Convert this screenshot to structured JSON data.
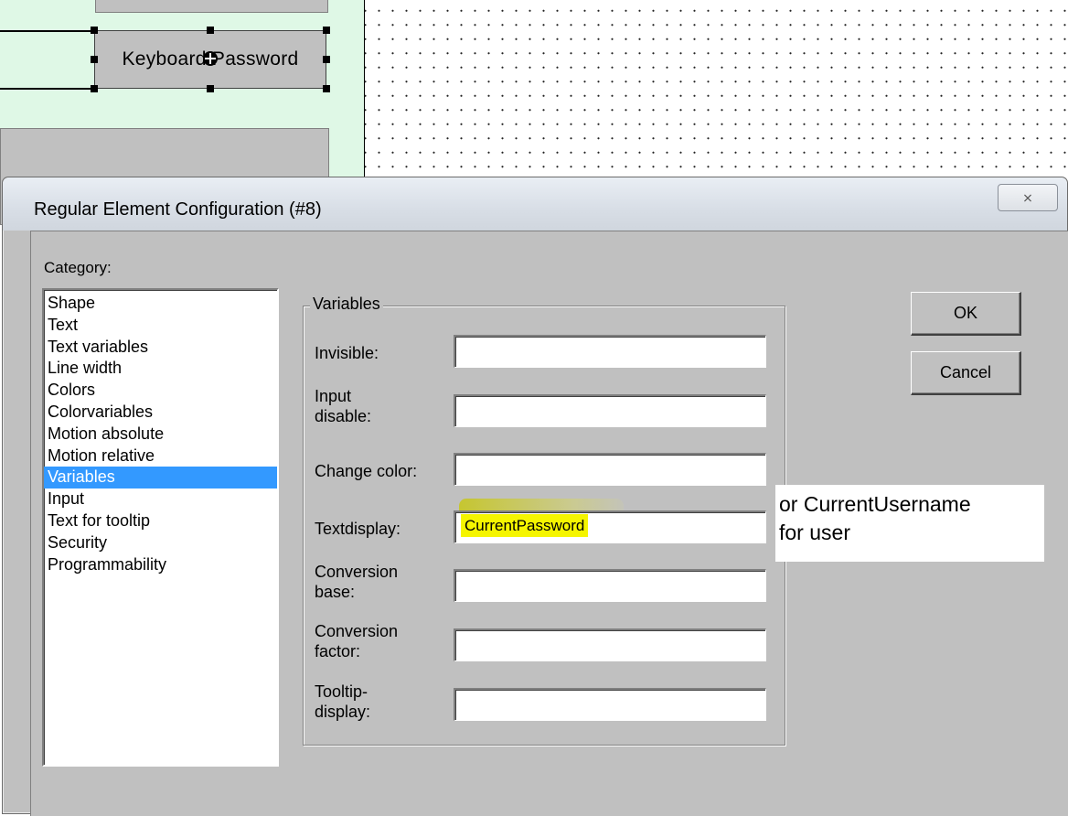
{
  "editor": {
    "selected_element_text": "Keyboard Password"
  },
  "dialog": {
    "title": "Regular Element Configuration (#8)",
    "close_label": "⨯",
    "category_label": "Category:",
    "categories": [
      {
        "label": "Shape"
      },
      {
        "label": "Text"
      },
      {
        "label": "Text variables"
      },
      {
        "label": "Line width"
      },
      {
        "label": "Colors"
      },
      {
        "label": "Colorvariables"
      },
      {
        "label": "Motion absolute"
      },
      {
        "label": "Motion relative"
      },
      {
        "label": "Variables",
        "selected": true
      },
      {
        "label": "Input"
      },
      {
        "label": "Text for tooltip"
      },
      {
        "label": "Security"
      },
      {
        "label": "Programmability"
      }
    ],
    "group_title": "Variables",
    "fields": {
      "invisible": {
        "label": "Invisible:",
        "value": ""
      },
      "input_disable": {
        "label_line1": "Input",
        "label_line2": "disable:",
        "value": ""
      },
      "change_color": {
        "label": "Change color:",
        "value": ""
      },
      "textdisplay": {
        "label": "Textdisplay:",
        "value": "CurrentPassword"
      },
      "conversion_base": {
        "label_line1": "Conversion",
        "label_line2": "base:",
        "value": ""
      },
      "conversion_factor": {
        "label_line1": "Conversion",
        "label_line2": "factor:",
        "value": ""
      },
      "tooltip_display": {
        "label_line1": "Tooltip-",
        "label_line2": "display:",
        "value": ""
      }
    },
    "ok_label": "OK",
    "cancel_label": "Cancel"
  },
  "annotation": {
    "line1": "or CurrentUsername",
    "line2": "for user"
  },
  "colors": {
    "dialog_face": "#c0c0c0",
    "selection": "#3399ff",
    "highlight": "#f5f500",
    "editor_bg": "#dff8e6"
  }
}
